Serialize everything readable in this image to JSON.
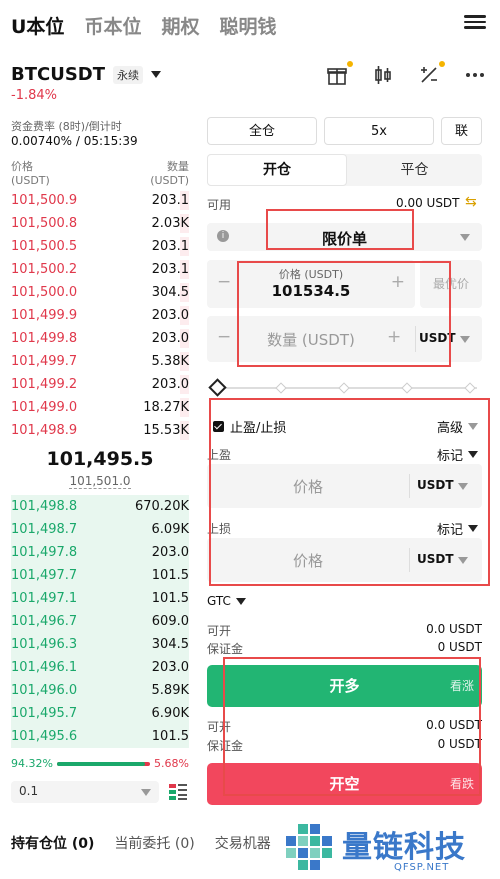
{
  "top_tabs": [
    "U本位",
    "币本位",
    "期权",
    "聪明钱"
  ],
  "symbol": {
    "name": "BTCUSDT",
    "type": "永续",
    "change": "-1.84%"
  },
  "funding": {
    "label": "资金费率 (8时)/倒计时",
    "value": "0.00740% / 05:15:39"
  },
  "orderbook": {
    "price_label": "价格",
    "price_unit": "(USDT)",
    "qty_label": "数量",
    "qty_unit": "(USDT)",
    "asks": [
      {
        "price": "101,500.9",
        "qty": "203.1",
        "depth": 0.05
      },
      {
        "price": "101,500.8",
        "qty": "2.03K",
        "depth": 0.05
      },
      {
        "price": "101,500.5",
        "qty": "203.1",
        "depth": 0.05
      },
      {
        "price": "101,500.2",
        "qty": "203.1",
        "depth": 0.05
      },
      {
        "price": "101,500.0",
        "qty": "304.5",
        "depth": 0.05
      },
      {
        "price": "101,499.9",
        "qty": "203.0",
        "depth": 0.05
      },
      {
        "price": "101,499.8",
        "qty": "203.0",
        "depth": 0.05
      },
      {
        "price": "101,499.7",
        "qty": "5.38K",
        "depth": 0.05
      },
      {
        "price": "101,499.2",
        "qty": "203.0",
        "depth": 0.05
      },
      {
        "price": "101,499.0",
        "qty": "18.27K",
        "depth": 0.05
      },
      {
        "price": "101,498.9",
        "qty": "15.53K",
        "depth": 0.05
      }
    ],
    "last_price": "101,495.5",
    "mark_price": "101,501.0",
    "bids": [
      {
        "price": "101,498.8",
        "qty": "670.20K"
      },
      {
        "price": "101,498.7",
        "qty": "6.09K"
      },
      {
        "price": "101,497.8",
        "qty": "203.0"
      },
      {
        "price": "101,497.7",
        "qty": "101.5"
      },
      {
        "price": "101,497.1",
        "qty": "101.5"
      },
      {
        "price": "101,496.7",
        "qty": "609.0"
      },
      {
        "price": "101,496.3",
        "qty": "304.5"
      },
      {
        "price": "101,496.1",
        "qty": "203.0"
      },
      {
        "price": "101,496.0",
        "qty": "5.89K"
      },
      {
        "price": "101,495.7",
        "qty": "6.90K"
      },
      {
        "price": "101,495.6",
        "qty": "101.5"
      }
    ],
    "buy_ratio": "94.32%",
    "sell_ratio": "5.68%",
    "buy_fraction": 0.9432,
    "precision": "0.1"
  },
  "order": {
    "margin_mode": "全仓",
    "leverage": "5x",
    "extra": "联",
    "open_tab": "开仓",
    "close_tab": "平仓",
    "available_label": "可用",
    "available_value": "0.00 USDT",
    "order_type": "限价单",
    "price_label": "价格 (USDT)",
    "price_value": "101534.5",
    "best_price": "最优价",
    "qty_placeholder": "数量 (USDT)",
    "qty_unit": "USDT",
    "tpsl_label": "止盈/止损",
    "advanced": "高级",
    "tp_label": "上盈",
    "tp_trigger": "标记",
    "tp_placeholder": "价格",
    "tp_unit": "USDT",
    "sl_label": "上损",
    "sl_trigger": "标记",
    "sl_placeholder": "价格",
    "sl_unit": "USDT",
    "tif": "GTC",
    "open_label": "可开",
    "open_value_long": "0.0 USDT",
    "margin_label": "保证金",
    "margin_value_long": "0 USDT",
    "long_btn": "开多",
    "long_hint": "看涨",
    "open_value_short": "0.0 USDT",
    "margin_value_short": "0 USDT",
    "short_btn": "开空",
    "short_hint": "看跌"
  },
  "bottom_tabs": [
    "持有仓位 (0)",
    "当前委托 (0)",
    "交易机器"
  ],
  "brand": {
    "name": "量链科技",
    "url": "QFSP.NET"
  },
  "colors": {
    "up": "#1aa86b",
    "down": "#e0384b",
    "highlight_box": "#e84a4a"
  }
}
